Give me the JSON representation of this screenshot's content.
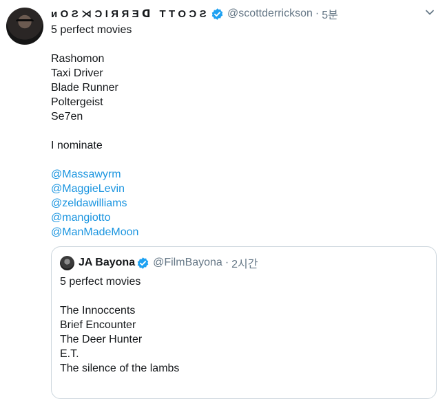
{
  "tweet": {
    "author": {
      "display_name": "ᴎOƧ⋊ƆIЯЯƎᗡ TTOƆƧ",
      "handle": "@scottderrickson",
      "time": "5분"
    },
    "text_lines": [
      "5 perfect movies",
      "",
      "Rashomon",
      "Taxi Driver",
      "Blade Runner",
      "Poltergeist",
      "Se7en",
      "",
      "I nominate",
      ""
    ],
    "mentions": [
      "@Massawyrm",
      "@MaggieLevin",
      "@zeldawilliams",
      "@mangiotto",
      "@ManMadeMoon"
    ]
  },
  "quoted_tweet": {
    "author": {
      "display_name": "JA Bayona",
      "handle": "@FilmBayona",
      "time": "2시간"
    },
    "text_lines": [
      "5 perfect movies",
      "",
      "The Innoccents",
      "Brief Encounter",
      "The Deer Hunter",
      "E.T.",
      "The silence of the lambs"
    ]
  },
  "colors": {
    "link": "#1b95e0",
    "verified": "#1da1f2",
    "muted": "#657786",
    "border": "#ccd6dd"
  },
  "icons": [
    "avatar",
    "verified-badge-icon",
    "chevron-down-icon"
  ],
  "separator": "·"
}
